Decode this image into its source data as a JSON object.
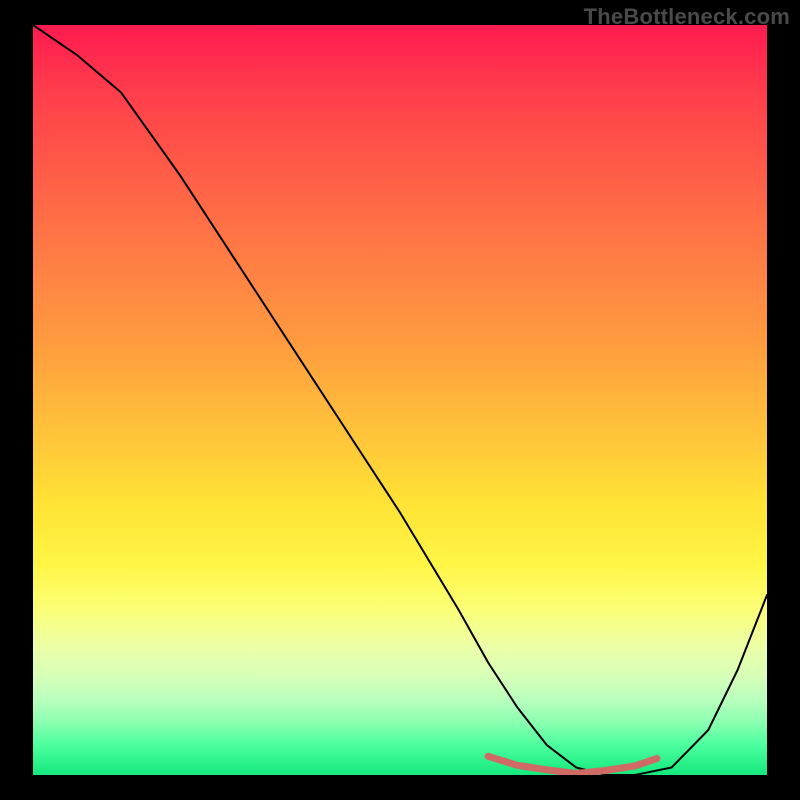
{
  "watermark": "TheBottleneck.com",
  "chart_data": {
    "type": "line",
    "title": "",
    "xlabel": "",
    "ylabel": "",
    "xlim": [
      0,
      100
    ],
    "ylim": [
      0,
      100
    ],
    "series": [
      {
        "name": "bottleneck-curve",
        "x": [
          0,
          6,
          12,
          20,
          30,
          40,
          50,
          58,
          62,
          66,
          70,
          74,
          78,
          82,
          87,
          92,
          96,
          100
        ],
        "values": [
          100,
          96,
          91,
          80,
          65,
          50,
          35,
          22,
          15,
          9,
          4,
          1,
          0,
          0,
          1,
          6,
          14,
          24
        ],
        "color": "#000000",
        "stroke_width": 2
      },
      {
        "name": "optimal-band",
        "x": [
          62,
          66,
          70,
          74,
          78,
          82,
          85
        ],
        "values": [
          2.5,
          1.3,
          0.7,
          0.2,
          0.6,
          1.2,
          2.2
        ],
        "color": "#cf6a65",
        "stroke_width": 7
      }
    ],
    "background_gradient": {
      "top_color": "#ff1a4f",
      "upper_mid_color": "#ff9a3f",
      "mid_color": "#ffe335",
      "lower_mid_color": "#ecffa8",
      "bottom_color": "#14e87c"
    }
  }
}
